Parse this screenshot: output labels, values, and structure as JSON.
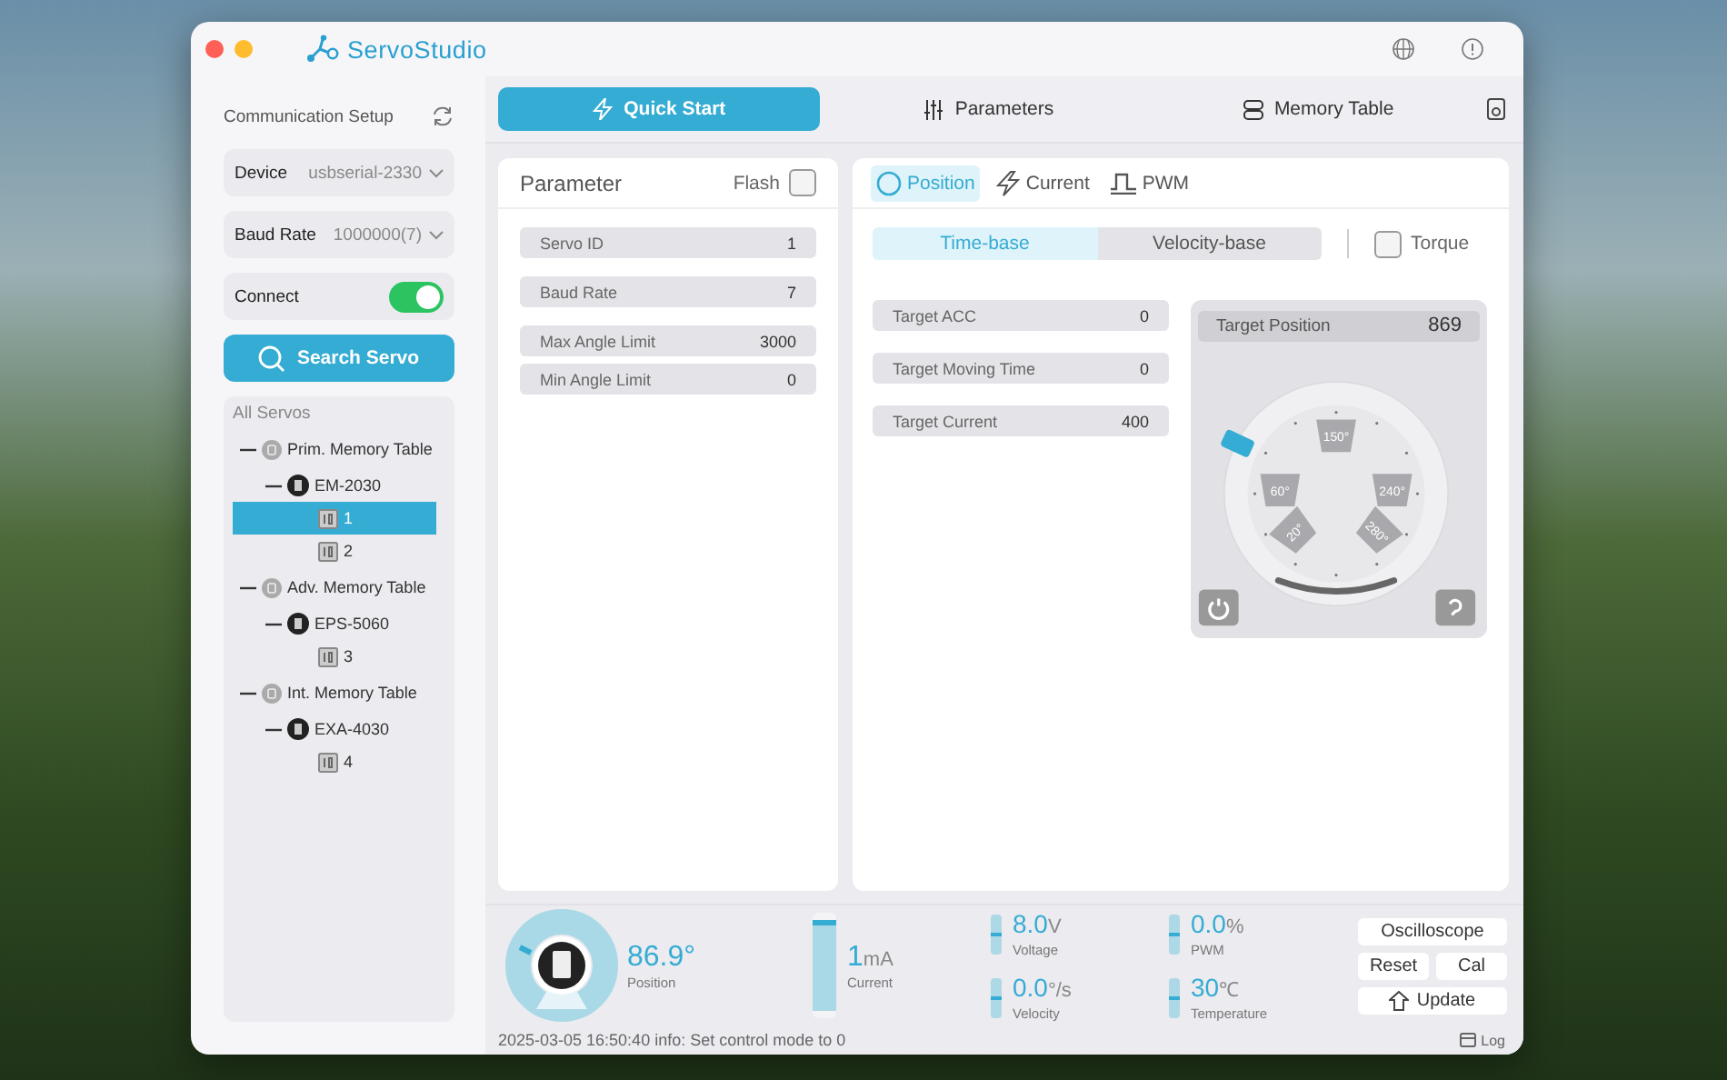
{
  "window": {
    "app_name": "ServoStudio"
  },
  "sidebar": {
    "title": "Communication Setup",
    "selects": [
      {
        "label": "Device",
        "value": "usbserial-2330"
      },
      {
        "label": "Baud Rate",
        "value": "1000000(7)"
      }
    ],
    "connect": {
      "label": "Connect",
      "on": true
    },
    "search_button": "Search Servo",
    "tree": {
      "title": "All Servos",
      "items": [
        {
          "label": "Prim. Memory Table",
          "expanded": true,
          "children": [
            {
              "label": "EM-2030",
              "expanded": true,
              "children": [
                {
                  "label": "1",
                  "selected": true
                },
                {
                  "label": "2",
                  "selected": false
                }
              ]
            }
          ]
        },
        {
          "label": "Adv. Memory Table",
          "expanded": true,
          "children": [
            {
              "label": "EPS-5060",
              "expanded": true,
              "children": [
                {
                  "label": "3",
                  "selected": false
                }
              ]
            }
          ]
        },
        {
          "label": "Int. Memory Table",
          "expanded": true,
          "children": [
            {
              "label": "EXA-4030",
              "expanded": true,
              "children": [
                {
                  "label": "4",
                  "selected": false
                }
              ]
            }
          ]
        }
      ]
    }
  },
  "nav": {
    "items": [
      {
        "label": "Quick Start",
        "selected": true
      },
      {
        "label": "Parameters",
        "selected": false
      },
      {
        "label": "Memory Table",
        "selected": false
      }
    ]
  },
  "parameter_panel": {
    "title": "Parameter",
    "flash": {
      "label": "Flash",
      "checked": false
    },
    "field_groups": [
      [
        {
          "label": "Servo ID",
          "value": "1"
        }
      ],
      [
        {
          "label": "Baud Rate",
          "value": "7"
        }
      ],
      [
        {
          "label": "Max Angle Limit",
          "value": "3000"
        },
        {
          "label": "Min Angle Limit",
          "value": "0"
        }
      ]
    ]
  },
  "control_panel": {
    "mode_tabs": [
      {
        "label": "Position",
        "selected": true
      },
      {
        "label": "Current",
        "selected": false
      },
      {
        "label": "PWM",
        "selected": false
      }
    ],
    "base_tabs": [
      {
        "label": "Time-base",
        "selected": true
      },
      {
        "label": "Velocity-base",
        "selected": false
      }
    ],
    "torque": {
      "label": "Torque",
      "checked": false
    },
    "targets": [
      {
        "label": "Target ACC",
        "value": "0"
      },
      {
        "label": "Target Moving Time",
        "value": "0"
      },
      {
        "label": "Target Current",
        "value": "400"
      }
    ],
    "dial": {
      "label": "Target Position",
      "value": "869",
      "presets": [
        "150°",
        "60°",
        "240°",
        "20°",
        "280°"
      ]
    }
  },
  "status": {
    "position": {
      "value": "86.9°",
      "label": "Position"
    },
    "current": {
      "value": "1",
      "unit": "mA",
      "label": "Current"
    },
    "meters": [
      {
        "value": "8.0",
        "unit": "V",
        "label": "Voltage"
      },
      {
        "value": "0.0",
        "unit": "%",
        "label": "PWM"
      },
      {
        "value": "0.0",
        "unit": "°/s",
        "label": "Velocity"
      },
      {
        "value": "30",
        "unit": "℃",
        "label": "Temperature"
      }
    ],
    "buttons": [
      "Oscilloscope",
      "Reset",
      "Cal",
      "Update"
    ]
  },
  "log": {
    "message": "2025-03-05 16:50:40 info: Set control mode to 0",
    "button": "Log"
  }
}
